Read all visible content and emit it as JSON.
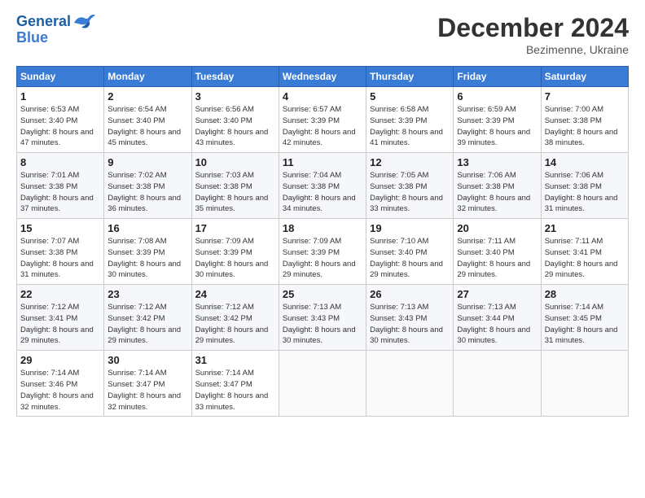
{
  "header": {
    "logo_line1": "General",
    "logo_line2": "Blue",
    "month": "December 2024",
    "location": "Bezimenne, Ukraine"
  },
  "weekdays": [
    "Sunday",
    "Monday",
    "Tuesday",
    "Wednesday",
    "Thursday",
    "Friday",
    "Saturday"
  ],
  "weeks": [
    [
      {
        "day": "1",
        "sunrise": "6:53 AM",
        "sunset": "3:40 PM",
        "daylight": "8 hours and 47 minutes."
      },
      {
        "day": "2",
        "sunrise": "6:54 AM",
        "sunset": "3:40 PM",
        "daylight": "8 hours and 45 minutes."
      },
      {
        "day": "3",
        "sunrise": "6:56 AM",
        "sunset": "3:40 PM",
        "daylight": "8 hours and 43 minutes."
      },
      {
        "day": "4",
        "sunrise": "6:57 AM",
        "sunset": "3:39 PM",
        "daylight": "8 hours and 42 minutes."
      },
      {
        "day": "5",
        "sunrise": "6:58 AM",
        "sunset": "3:39 PM",
        "daylight": "8 hours and 41 minutes."
      },
      {
        "day": "6",
        "sunrise": "6:59 AM",
        "sunset": "3:39 PM",
        "daylight": "8 hours and 39 minutes."
      },
      {
        "day": "7",
        "sunrise": "7:00 AM",
        "sunset": "3:38 PM",
        "daylight": "8 hours and 38 minutes."
      }
    ],
    [
      {
        "day": "8",
        "sunrise": "7:01 AM",
        "sunset": "3:38 PM",
        "daylight": "8 hours and 37 minutes."
      },
      {
        "day": "9",
        "sunrise": "7:02 AM",
        "sunset": "3:38 PM",
        "daylight": "8 hours and 36 minutes."
      },
      {
        "day": "10",
        "sunrise": "7:03 AM",
        "sunset": "3:38 PM",
        "daylight": "8 hours and 35 minutes."
      },
      {
        "day": "11",
        "sunrise": "7:04 AM",
        "sunset": "3:38 PM",
        "daylight": "8 hours and 34 minutes."
      },
      {
        "day": "12",
        "sunrise": "7:05 AM",
        "sunset": "3:38 PM",
        "daylight": "8 hours and 33 minutes."
      },
      {
        "day": "13",
        "sunrise": "7:06 AM",
        "sunset": "3:38 PM",
        "daylight": "8 hours and 32 minutes."
      },
      {
        "day": "14",
        "sunrise": "7:06 AM",
        "sunset": "3:38 PM",
        "daylight": "8 hours and 31 minutes."
      }
    ],
    [
      {
        "day": "15",
        "sunrise": "7:07 AM",
        "sunset": "3:38 PM",
        "daylight": "8 hours and 31 minutes."
      },
      {
        "day": "16",
        "sunrise": "7:08 AM",
        "sunset": "3:39 PM",
        "daylight": "8 hours and 30 minutes."
      },
      {
        "day": "17",
        "sunrise": "7:09 AM",
        "sunset": "3:39 PM",
        "daylight": "8 hours and 30 minutes."
      },
      {
        "day": "18",
        "sunrise": "7:09 AM",
        "sunset": "3:39 PM",
        "daylight": "8 hours and 29 minutes."
      },
      {
        "day": "19",
        "sunrise": "7:10 AM",
        "sunset": "3:40 PM",
        "daylight": "8 hours and 29 minutes."
      },
      {
        "day": "20",
        "sunrise": "7:11 AM",
        "sunset": "3:40 PM",
        "daylight": "8 hours and 29 minutes."
      },
      {
        "day": "21",
        "sunrise": "7:11 AM",
        "sunset": "3:41 PM",
        "daylight": "8 hours and 29 minutes."
      }
    ],
    [
      {
        "day": "22",
        "sunrise": "7:12 AM",
        "sunset": "3:41 PM",
        "daylight": "8 hours and 29 minutes."
      },
      {
        "day": "23",
        "sunrise": "7:12 AM",
        "sunset": "3:42 PM",
        "daylight": "8 hours and 29 minutes."
      },
      {
        "day": "24",
        "sunrise": "7:12 AM",
        "sunset": "3:42 PM",
        "daylight": "8 hours and 29 minutes."
      },
      {
        "day": "25",
        "sunrise": "7:13 AM",
        "sunset": "3:43 PM",
        "daylight": "8 hours and 30 minutes."
      },
      {
        "day": "26",
        "sunrise": "7:13 AM",
        "sunset": "3:43 PM",
        "daylight": "8 hours and 30 minutes."
      },
      {
        "day": "27",
        "sunrise": "7:13 AM",
        "sunset": "3:44 PM",
        "daylight": "8 hours and 30 minutes."
      },
      {
        "day": "28",
        "sunrise": "7:14 AM",
        "sunset": "3:45 PM",
        "daylight": "8 hours and 31 minutes."
      }
    ],
    [
      {
        "day": "29",
        "sunrise": "7:14 AM",
        "sunset": "3:46 PM",
        "daylight": "8 hours and 32 minutes."
      },
      {
        "day": "30",
        "sunrise": "7:14 AM",
        "sunset": "3:47 PM",
        "daylight": "8 hours and 32 minutes."
      },
      {
        "day": "31",
        "sunrise": "7:14 AM",
        "sunset": "3:47 PM",
        "daylight": "8 hours and 33 minutes."
      },
      null,
      null,
      null,
      null
    ]
  ]
}
